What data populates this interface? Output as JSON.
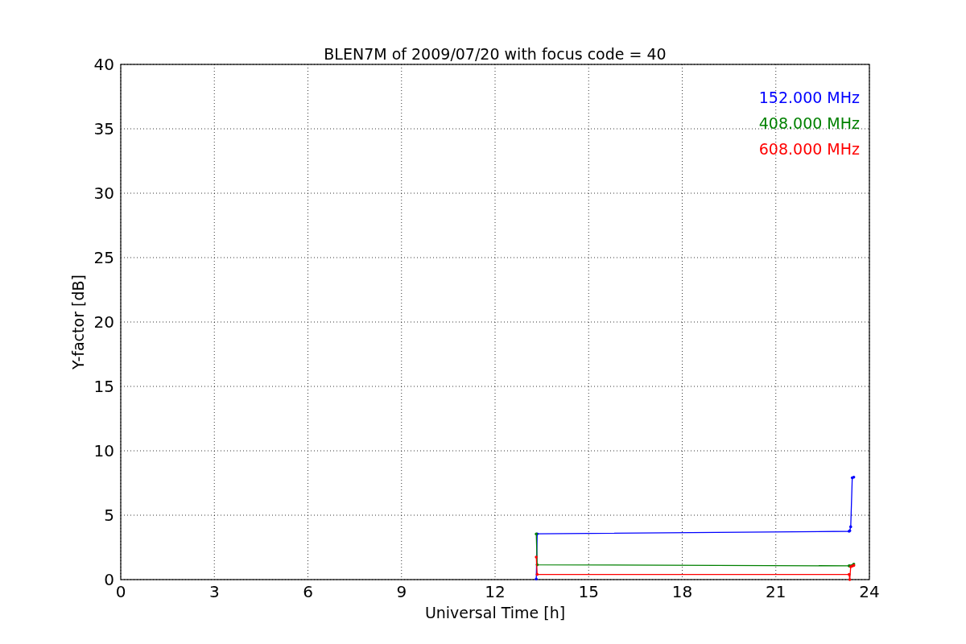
{
  "chart_data": {
    "type": "line",
    "title": "BLEN7M of 2009/07/20 with focus code = 40",
    "xlabel": "Universal Time [h]",
    "ylabel": "Y-factor [dB]",
    "x": [
      13.32,
      13.35,
      23.35,
      23.37,
      23.4,
      23.45,
      23.5
    ],
    "series": [
      {
        "name": "152.000 MHz",
        "color": "#0000ff",
        "values": [
          0.05,
          3.55,
          3.75,
          3.8,
          4.1,
          7.9,
          7.95
        ]
      },
      {
        "name": "408.000 MHz",
        "color": "#008000",
        "values": [
          3.55,
          1.15,
          1.07,
          1.06,
          1.05,
          1.1,
          1.2
        ]
      },
      {
        "name": "608.000 MHz",
        "color": "#ff0000",
        "values": [
          1.75,
          0.4,
          0.4,
          0.0,
          1.0,
          1.05,
          1.1
        ]
      }
    ],
    "xlim": [
      0,
      24
    ],
    "ylim": [
      0,
      40
    ],
    "xticks": [
      0,
      3,
      6,
      9,
      12,
      15,
      18,
      21,
      24
    ],
    "yticks": [
      0,
      5,
      10,
      15,
      20,
      25,
      30,
      35,
      40
    ],
    "grid": true
  }
}
